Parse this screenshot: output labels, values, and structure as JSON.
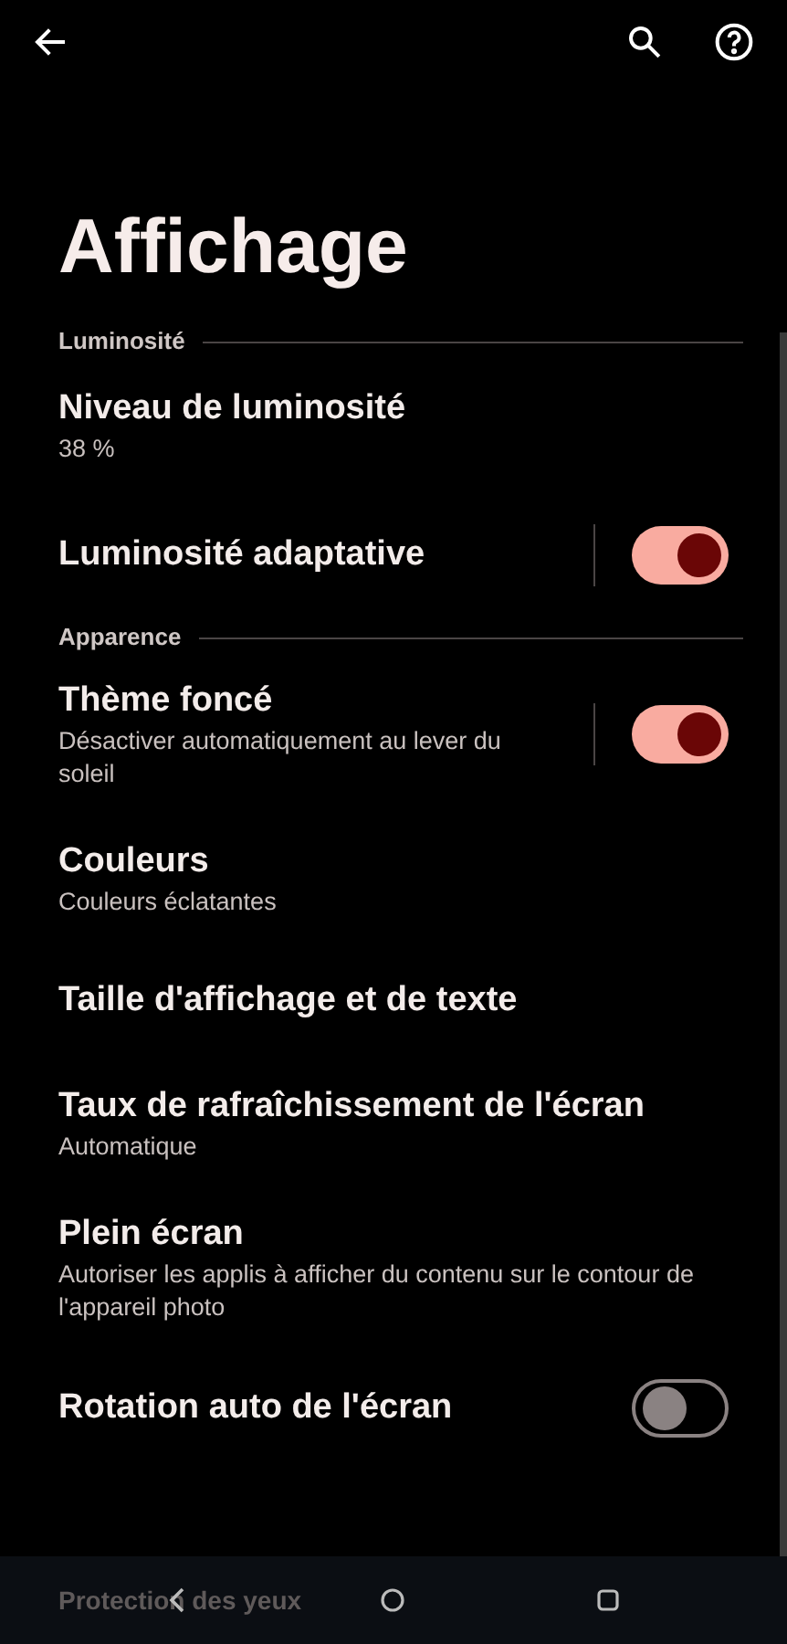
{
  "title": "Affichage",
  "sections": [
    {
      "header": "Luminosité",
      "items": [
        {
          "kind": "plain",
          "title": "Niveau de luminosité",
          "subtitle": "38 %"
        },
        {
          "kind": "toggle",
          "title": "Luminosité adaptative",
          "on": true
        }
      ]
    },
    {
      "header": "Apparence",
      "items": [
        {
          "kind": "toggle",
          "title": "Thème foncé",
          "subtitle": "Désactiver automatiquement au lever du soleil",
          "on": true
        },
        {
          "kind": "plain",
          "title": "Couleurs",
          "subtitle": "Couleurs éclatantes"
        },
        {
          "kind": "plain",
          "title": "Taille d'affichage et de texte"
        },
        {
          "kind": "plain",
          "title": "Taux de rafraîchissement de l'écran",
          "subtitle": "Automatique"
        },
        {
          "kind": "plain",
          "title": "Plein écran",
          "subtitle": "Autoriser les applis à afficher du contenu sur le contour de l'appareil photo"
        },
        {
          "kind": "switch",
          "title": "Rotation auto de l'écran",
          "on": false
        }
      ]
    }
  ],
  "behind_nav": {
    "title": "Protection des yeux"
  }
}
